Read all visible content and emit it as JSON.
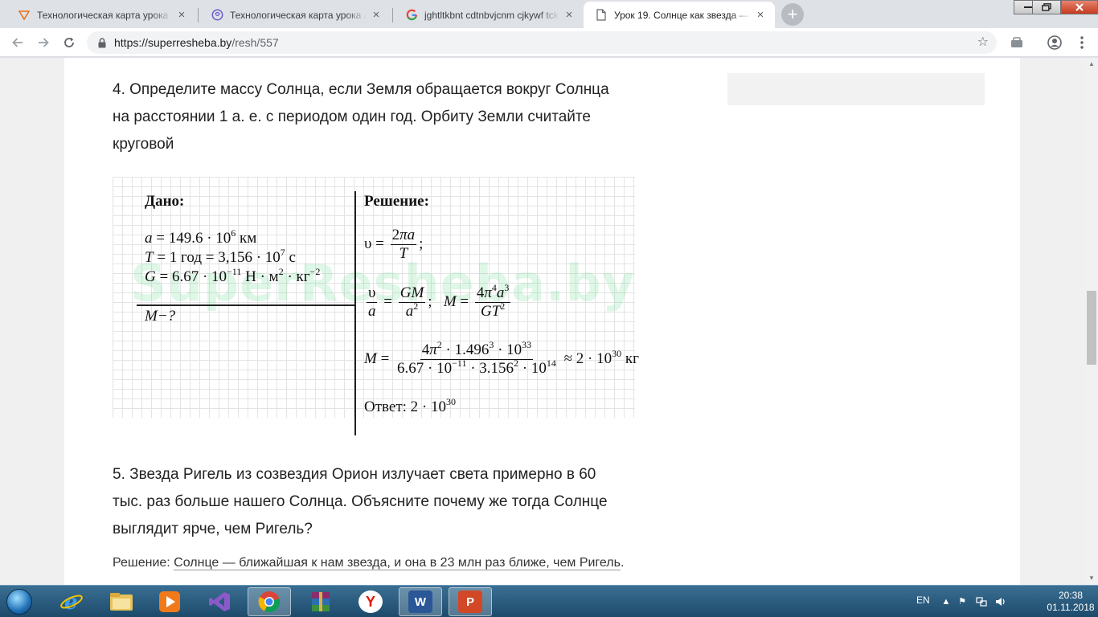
{
  "browser": {
    "tabs": [
      {
        "title": "Технологическая карта урока а",
        "icon": "presentation-favicon",
        "active": false
      },
      {
        "title": "Технологическая карта урока а",
        "icon": "circle-favicon",
        "active": false
      },
      {
        "title": "jghtltkbnt cdtnbvjcnm cjkywf tckl",
        "icon": "google-favicon",
        "active": false
      },
      {
        "title": "Урок 19. Солнце как звезда — А",
        "icon": "page-favicon",
        "active": true
      }
    ],
    "url_host": "https://superresheba.by",
    "url_path": "/resh/557"
  },
  "content": {
    "q4_text": "4. Определите массу Солнца, если Земля обращается вокруг Солнца на расстоянии 1 а. е. с периодом один год. Орбиту Земли считайте круговой",
    "given": {
      "heading": "Дано:",
      "a": "= 149.6 · 10",
      "a_exp": "6",
      "a_unit": " км",
      "t": "= 1 год = 3,156 · 10",
      "t_exp": "7",
      "t_unit": " с",
      "g": "= 6.67 · 10",
      "g_exp": "−11",
      "g_unit": " Н · м",
      "g_unit_exp": "2",
      "g_unit2": " · кг",
      "g_unit2_exp": "−2",
      "find": "M−?"
    },
    "solution": {
      "heading": "Решение:",
      "answer_label": "Ответ: 2 · 10",
      "answer_exp": "30",
      "result": "≈ 2 · 10",
      "result_exp": "30",
      "result_unit": " кг"
    },
    "watermark": "SuperResheba.by",
    "q5_text": "5. Звезда Ригель из созвездия Орион излучает света примерно в 60 тыс. раз больше нашего Солнца. Объясните почему же тогда Солнце выглядит ярче, чем Ригель?",
    "answer_prefix": "Решение: ",
    "answer_text": "Солнце — ближайшая к нам звезда, и она в 23 млн раз ближе, чем Ригель",
    "answer_suffix": "."
  },
  "taskbar": {
    "apps": [
      "internet-explorer-icon",
      "file-explorer-icon",
      "media-player-icon",
      "visual-studio-icon",
      "chrome-icon",
      "winrar-icon",
      "yandex-browser-icon",
      "word-icon",
      "powerpoint-icon"
    ],
    "word_letter": "W",
    "ppt_letter": "P",
    "yandex_letter": "Y",
    "lang": "EN",
    "time": "20:38",
    "date": "01.11.2018"
  }
}
